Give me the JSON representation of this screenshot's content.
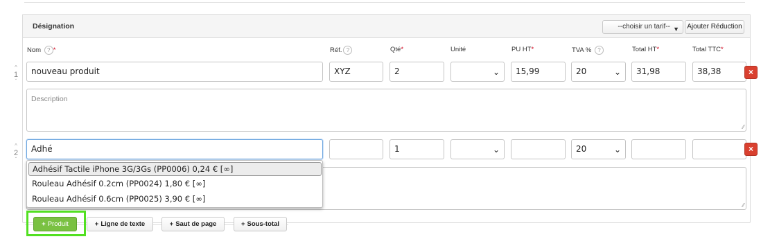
{
  "header": {
    "title": "Désignation",
    "tarif_select": "--choisir un tarif--",
    "add_reduction": "Ajouter Réduction"
  },
  "columns": {
    "nom": "Nom",
    "ref": "Réf.",
    "qte": "Qté",
    "unite": "Unité",
    "pu_ht": "PU HT",
    "tva": "TVA %",
    "total_ht": "Total HT",
    "total_ttc": "Total TTC",
    "help": "?",
    "required_mark": "*"
  },
  "rows": [
    {
      "num": "1",
      "nom": "nouveau produit",
      "ref": "XYZ",
      "qte": "2",
      "unite": "",
      "pu_ht": "15,99",
      "tva": "20",
      "total_ht": "31,98",
      "total_ttc": "38,38",
      "description_placeholder": "Description"
    },
    {
      "num": "2",
      "nom": "Adhé",
      "ref": "",
      "qte": "1",
      "unite": "",
      "pu_ht": "",
      "tva": "20",
      "total_ht": "",
      "total_ttc": ""
    }
  ],
  "autocomplete": [
    "Adhésif Tactile iPhone 3G/3Gs (PP0006) 0,24 € [∞]",
    "Rouleau Adhésif 0.2cm (PP0024) 1,80 € [∞]",
    "Rouleau Adhésif 0.6cm (PP0025) 3,90 € [∞]"
  ],
  "actions": {
    "produit": "Produit",
    "ligne_texte": "Ligne de texte",
    "saut_page": "Saut de page",
    "sous_total": "Sous-total"
  },
  "icons": {
    "delete": "×",
    "plus": "+",
    "chevron": "❯",
    "arrow_up": "^",
    "arrow_down": "ˇ",
    "grip": "⁄⁄"
  },
  "colors": {
    "delete_button": "#d9402f",
    "produit_button": "#7ac142",
    "highlight_outline": "#52e021",
    "required": "#d0021b"
  }
}
